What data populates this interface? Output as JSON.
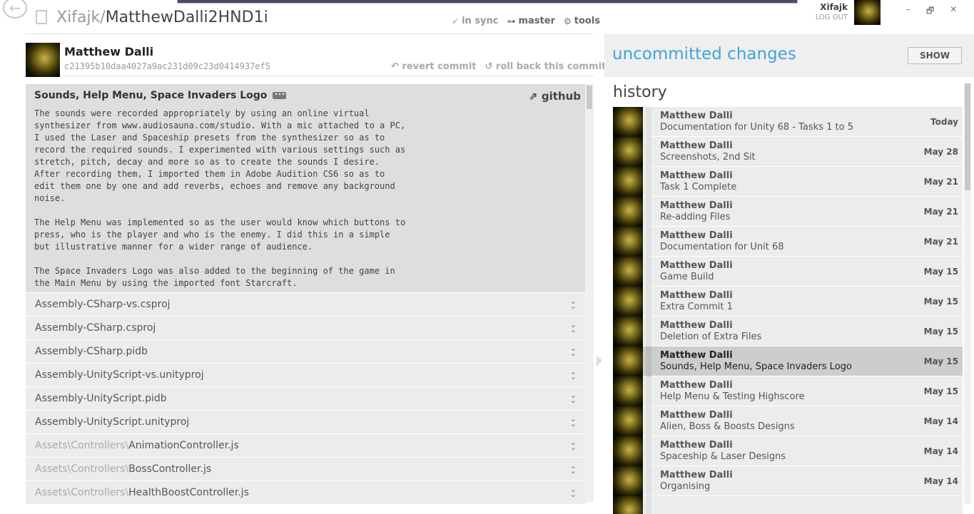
{
  "header": {
    "repo_owner": "Xifajk",
    "repo_sep": "/",
    "repo_name": "MatthewDalli2HND1i",
    "sync_label": "in sync",
    "branch_label": "master",
    "tools_label": "tools",
    "user_name": "Xifajk",
    "logout_label": "LOG OUT",
    "window_minimize": "–",
    "window_restore": "🗗",
    "window_close": "✕"
  },
  "commit": {
    "author": "Matthew Dalli",
    "sha": "c21395b10daa4027a9ac231d09c23d0414937ef5",
    "revert_label": "revert commit",
    "rollback_label": "roll back this commit",
    "title": "Sounds, Help Menu, Space Invaders Logo",
    "github_label": "github",
    "message": "The sounds were recorded appropriately by using an online virtual\nsynthesizer from www.audiosauna.com/studio. With a mic attached to a PC,\nI used the Laser and Spaceship presets from the synthesizer so as to\nrecord the required sounds. I experimented with various settings such as\nstretch, pitch, decay and more so as to create the sounds I desire.\nAfter recording them, I imported them in Adobe Audition CS6 so as to\nedit them one by one and add reverbs, echoes and remove any background\nnoise.\n\nThe Help Menu was implemented so as the user would know which buttons to\npress, who is the player and who is the enemy. I did this in a simple\nbut illustrative manner for a wider range of audience.\n\nThe Space Invaders Logo was also added to the beginning of the game in\nthe Main Menu by using the imported font Starcraft."
  },
  "files": [
    {
      "path": "",
      "name": "Assembly-CSharp-vs.csproj"
    },
    {
      "path": "",
      "name": "Assembly-CSharp.csproj"
    },
    {
      "path": "",
      "name": "Assembly-CSharp.pidb"
    },
    {
      "path": "",
      "name": "Assembly-UnityScript-vs.unityproj"
    },
    {
      "path": "",
      "name": "Assembly-UnityScript.pidb"
    },
    {
      "path": "",
      "name": "Assembly-UnityScript.unityproj"
    },
    {
      "path": "Assets\\Controllers\\",
      "name": "AnimationController.js"
    },
    {
      "path": "Assets\\Controllers\\",
      "name": "BossController.js"
    },
    {
      "path": "Assets\\Controllers\\",
      "name": "HealthBoostController.js"
    }
  ],
  "uncommitted": {
    "title": "uncommitted changes",
    "show_label": "SHOW"
  },
  "history": {
    "title": "history",
    "items": [
      {
        "author": "Matthew Dalli",
        "message": "Documentation for Unity 68 - Tasks 1 to 5",
        "date": "Today",
        "selected": false
      },
      {
        "author": "Matthew Dalli",
        "message": "Screenshots, 2nd Sit",
        "date": "May 28",
        "selected": false
      },
      {
        "author": "Matthew Dalli",
        "message": "Task 1 Complete",
        "date": "May 21",
        "selected": false
      },
      {
        "author": "Matthew Dalli",
        "message": "Re-adding Files",
        "date": "May 21",
        "selected": false
      },
      {
        "author": "Matthew Dalli",
        "message": "Documentation for Unit 68",
        "date": "May 21",
        "selected": false
      },
      {
        "author": "Matthew Dalli",
        "message": "Game Build",
        "date": "May 15",
        "selected": false
      },
      {
        "author": "Matthew Dalli",
        "message": "Extra Commit 1",
        "date": "May 15",
        "selected": false
      },
      {
        "author": "Matthew Dalli",
        "message": "Deletion of Extra Files",
        "date": "May 15",
        "selected": false
      },
      {
        "author": "Matthew Dalli",
        "message": "Sounds, Help Menu, Space Invaders Logo",
        "date": "May 15",
        "selected": true
      },
      {
        "author": "Matthew Dalli",
        "message": "Help Menu & Testing Highscore",
        "date": "May 15",
        "selected": false
      },
      {
        "author": "Matthew Dalli",
        "message": "Alien, Boss & Boosts Designs",
        "date": "May 14",
        "selected": false
      },
      {
        "author": "Matthew Dalli",
        "message": "Spaceship & Laser Designs",
        "date": "May 14",
        "selected": false
      },
      {
        "author": "Matthew Dalli",
        "message": "Organising",
        "date": "May 14",
        "selected": false
      },
      {
        "author": "",
        "message": "",
        "date": "",
        "selected": false
      }
    ]
  },
  "colors": {
    "accent": "#3ea4d9",
    "selected_row": "#cdcdcd",
    "commit_box": "#dedede"
  }
}
